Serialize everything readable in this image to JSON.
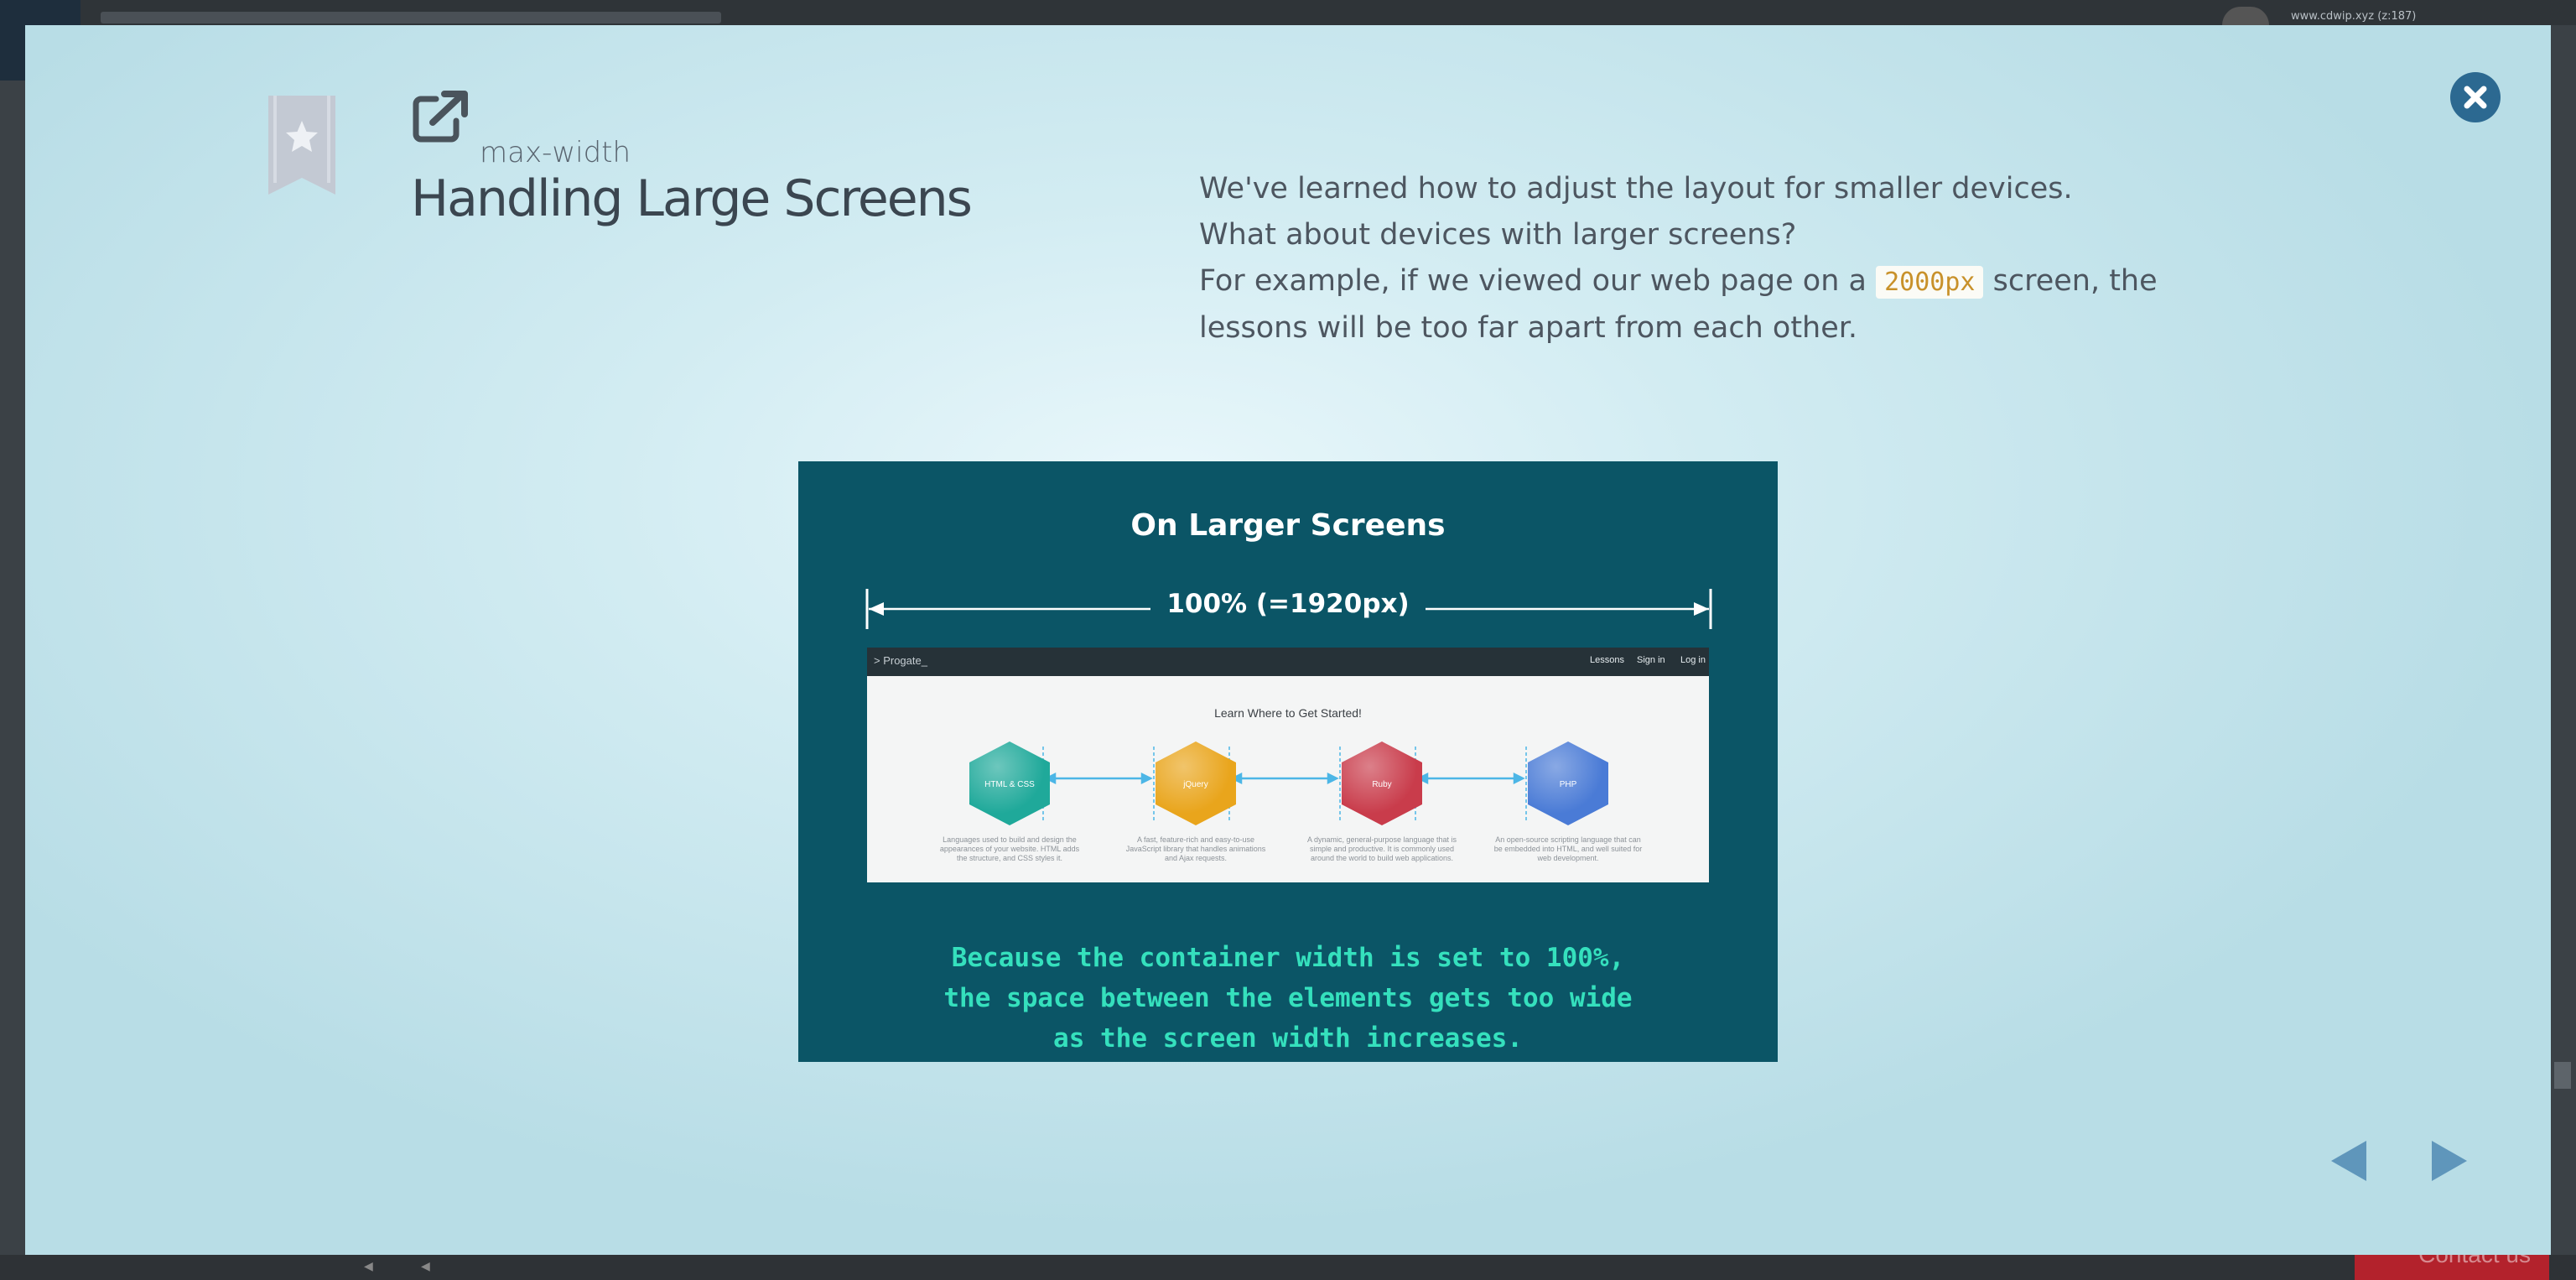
{
  "background": {
    "account_email": "www.cdwip.xyz (z:187)",
    "contact_label": "Contact us"
  },
  "modal": {
    "subtitle": "max-width",
    "title": "Handling Large Screens",
    "description": {
      "line1": "We've learned how to adjust the layout for smaller devices.",
      "line2": "What about devices with larger screens?",
      "line3_before": "For example, if we viewed our web page on a ",
      "line3_code": "2000px",
      "line3_after": " screen, the lessons will be too far apart from each other."
    },
    "slide": {
      "title": "On Larger Screens",
      "measure_label": "100% (=1920px)",
      "mock": {
        "logo": "> Progate_",
        "nav_links": [
          "Lessons",
          "Sign in",
          "Log in"
        ],
        "heading": "Learn Where to Get Started!",
        "items": [
          {
            "label": "HTML & CSS",
            "color": "#1fa99a",
            "desc": "Languages used to build and design the appearances of your website. HTML adds the structure, and CSS styles it."
          },
          {
            "label": "jQuery",
            "color": "#e9a51c",
            "desc": "A fast, feature-rich and easy-to-use JavaScript library that handles animations and Ajax requests."
          },
          {
            "label": "Ruby",
            "color": "#c93c4b",
            "desc": "A dynamic, general-purpose language that is simple and productive. It is commonly used around the world to build web applications."
          },
          {
            "label": "PHP",
            "color": "#4a7bd6",
            "desc": "An open-source scripting language that can be embedded into HTML, and well suited for web development."
          }
        ]
      },
      "caption": [
        "Because the container width is set to 100%,",
        "the space between the elements gets too wide",
        "as the screen width increases."
      ]
    }
  },
  "icons": {
    "close": "close-icon",
    "bookmark": "bookmark-star-icon",
    "external_link": "external-link-icon",
    "prev": "arrow-left-icon",
    "next": "arrow-right-icon"
  },
  "colors": {
    "close_button": "#2c6991",
    "nav_arrows": "#5f96bb",
    "slide_background": "#0b5566",
    "caption_text": "#35e0bd",
    "code_text": "#c8912a"
  }
}
